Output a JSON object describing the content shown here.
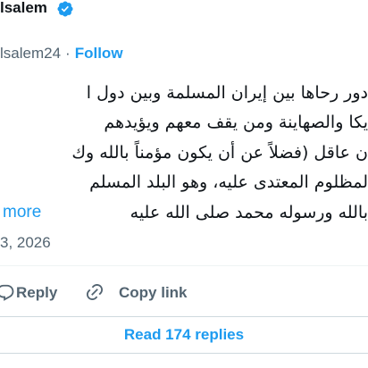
{
  "author": {
    "name": "lsalem",
    "verified_icon": "verified-badge-icon",
    "handle": "lsalem24",
    "separator": "·",
    "follow_label": "Follow"
  },
  "tweet": {
    "lines": [
      "دور رحاها بين إيران المسلمة وبين دول ا",
      "يكا والصهاينة ومن يقف معهم ويؤيدهم",
      "ن عاقل (فضلاً عن أن يكون مؤمناً بالله وك",
      "لمظلوم المعتدى عليه، وهو البلد المسلم",
      "بالله ورسوله محمد صلى الله عليه"
    ],
    "show_more_label": "more",
    "date": "3, 2026"
  },
  "actions": {
    "reply_icon": "reply-icon",
    "reply_label": "Reply",
    "copy_link_icon": "link-icon",
    "copy_link_label": "Copy link"
  },
  "replies_button": {
    "label": "Read 174 replies"
  },
  "colors": {
    "text": "#0f1419",
    "secondary": "#536471",
    "accent": "#1d9bf0",
    "divider": "#eff3f4",
    "button_border": "#cfd9de"
  }
}
